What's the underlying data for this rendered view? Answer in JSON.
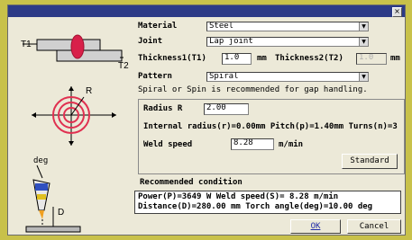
{
  "labels": {
    "material": "Material",
    "joint": "Joint",
    "thickness1": "Thickness1(T1)",
    "thickness1_unit": "mm",
    "thickness2": "Thickness2(T2)",
    "thickness2_unit": "mm",
    "pattern": "Pattern",
    "hint": "Spiral or Spin is recommended for gap handling.",
    "radius": "Radius R",
    "radius_info": "Internal radius(r)=0.00mm Pitch(p)=1.40mm Turns(n)=3",
    "weld_speed": "Weld speed",
    "weld_speed_unit": "m/min",
    "recommended": "Recommended condition"
  },
  "fields": {
    "material": "Steel",
    "joint": "Lap joint",
    "thickness1": "1.0",
    "thickness2": "1.0",
    "pattern": "Spiral",
    "radius": "2.00",
    "weld_speed": "8.28"
  },
  "buttons": {
    "standard": "Standard",
    "ok": "OK",
    "cancel": "Cancel",
    "close": "×"
  },
  "result": {
    "line1": "Power(P)=3649 W  Weld speed(S)= 8.28 m/min",
    "line2": "Distance(D)=280.00 mm  Torch angle(deg)=10.00 deg"
  },
  "diagram": {
    "t1": "T1",
    "t2": "T2",
    "r": "R",
    "deg": "deg",
    "d": "D"
  },
  "colors": {
    "titlebar": "#2c3a86",
    "background": "#c8c14a",
    "weld": "#d8204a"
  }
}
